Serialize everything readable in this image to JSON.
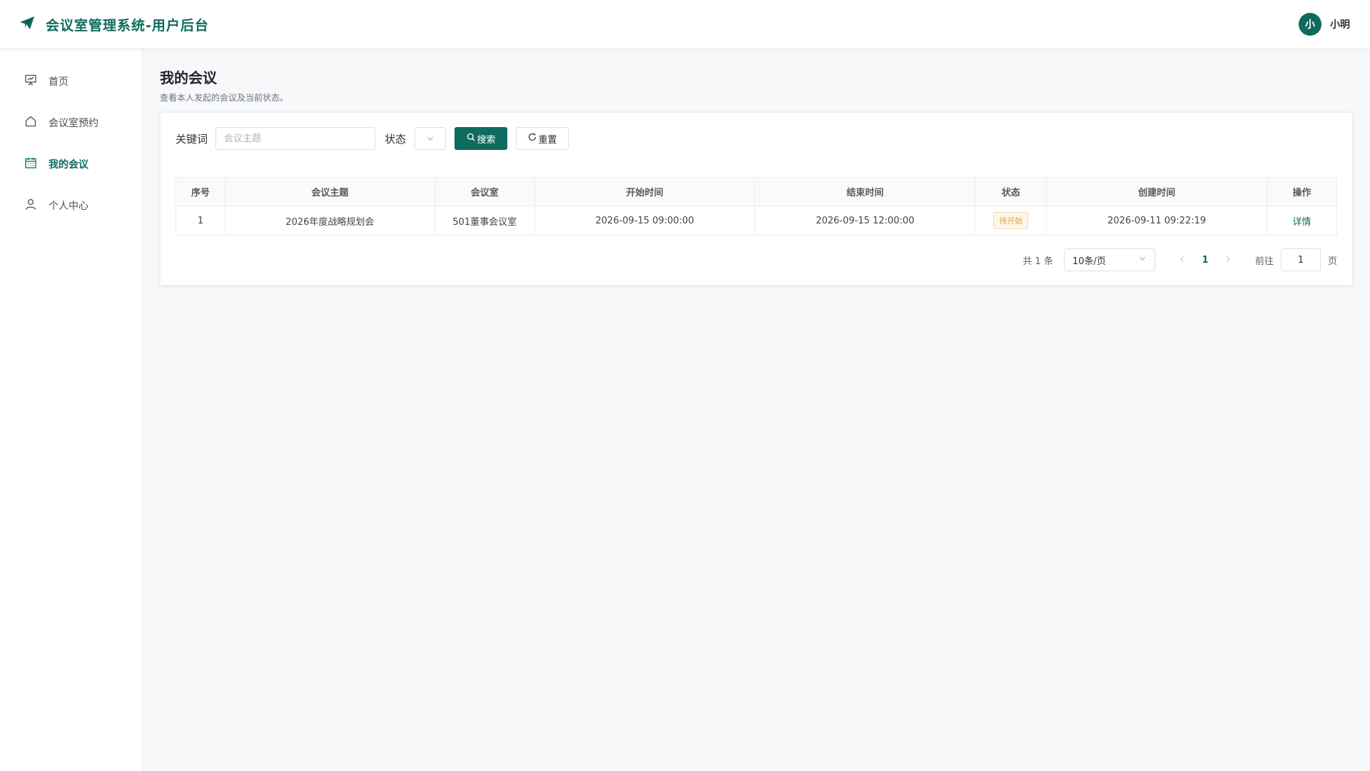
{
  "header": {
    "title": "会议室管理系统-用户后台",
    "brand_icon": "paper-plane-icon",
    "user": {
      "avatar_text": "小",
      "name": "小明"
    }
  },
  "colors": {
    "primary": "#0f6b5e",
    "warning": "#e6a23c",
    "background": "#f7f8fa"
  },
  "sidebar": {
    "items": [
      {
        "label": "首页",
        "icon": "presentation-board-icon",
        "active": false
      },
      {
        "label": "会议室预约",
        "icon": "home-icon",
        "active": false
      },
      {
        "label": "我的会议",
        "icon": "calendar-icon",
        "active": true
      },
      {
        "label": "个人中心",
        "icon": "user-icon",
        "active": false
      }
    ]
  },
  "page": {
    "title": "我的会议",
    "description": "查看本人发起的会议及当前状态。"
  },
  "filters": {
    "keyword_label": "关键词",
    "keyword_placeholder": "会议主题",
    "keyword_value": "",
    "status_label": "状态",
    "status_value": "",
    "search_label": "搜索",
    "reset_label": "重置"
  },
  "table": {
    "columns": [
      "序号",
      "会议主题",
      "会议室",
      "开始时间",
      "结束时间",
      "状态",
      "创建时间",
      "操作"
    ],
    "rows": [
      {
        "index": "1",
        "subject": "2026年度战略规划会",
        "room": "501董事会议室",
        "start": "2026-09-15 09:00:00",
        "end": "2026-09-15 12:00:00",
        "status": "待开始",
        "created": "2026-09-11 09:22:19",
        "action": "详情"
      }
    ]
  },
  "pagination": {
    "total_text": "共 1 条",
    "page_size": "10条/页",
    "current_page": "1",
    "goto_label": "前往",
    "goto_value": "1",
    "page_unit": "页"
  }
}
